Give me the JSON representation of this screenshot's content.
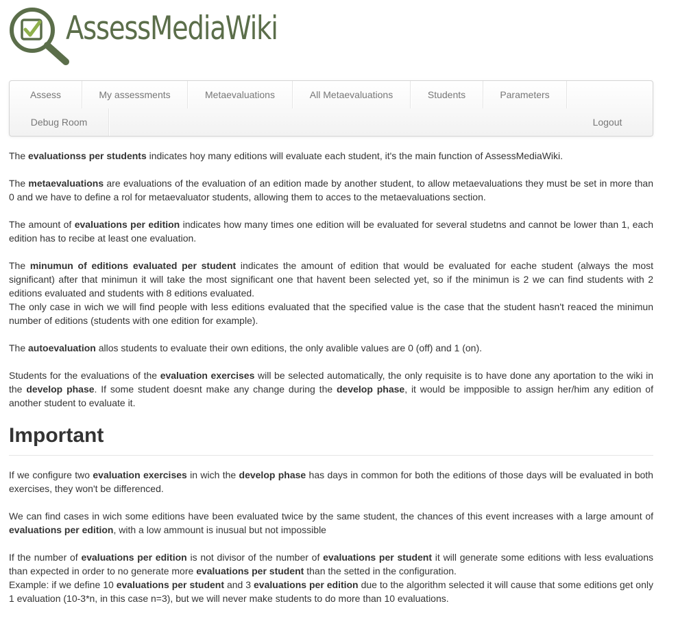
{
  "logo": {
    "text": "AssessMediaWiki",
    "icon": "magnifier-checkbox-icon",
    "color": "#5b6e4a"
  },
  "nav": {
    "row1": [
      "Assess",
      "My assessments",
      "Metaevaluations",
      "All Metaevaluations",
      "Students",
      "Parameters"
    ],
    "row2": [
      "Debug Room"
    ],
    "logout": "Logout"
  },
  "paragraphs": [
    [
      {
        "t": "The "
      },
      {
        "b": "evaluationss per students"
      },
      {
        "t": " indicates hoy many editions will evaluate each student, it's the main function of AssessMediaWiki."
      }
    ],
    [
      {
        "t": "The "
      },
      {
        "b": "metaevaluations"
      },
      {
        "t": " are evaluations of the evaluation of an edition made by another student, to allow metaevaluations they must be set in more than 0 and we have to define a rol for metaevaluator students, allowing them to acces to the metaevaluations section."
      }
    ],
    [
      {
        "t": "The amount of "
      },
      {
        "b": "evaluations per edition"
      },
      {
        "t": " indicates how many times one edition will be evaluated for several studetns and cannot be lower than 1, each edition has to recibe at least one evaluation."
      }
    ],
    [
      {
        "t": "The "
      },
      {
        "b": "minumun of editions evaluated per student"
      },
      {
        "t": " indicates the amount of edition that would be evaluated for eache student (always the most significant) after that minimun it will take the most significant one that havent been selected yet, so if the minimun is 2 we can find students with 2 editions evaluated and students with 8 editions evaluated."
      },
      {
        "br": true
      },
      {
        "t": "The only case in wich we will find people with less editions evaluated that the specified value is the case that the student hasn't reaced the minimun number of editions (students with one edition for example)."
      }
    ],
    [
      {
        "t": "The "
      },
      {
        "b": "autoevaluation"
      },
      {
        "t": " allos students to evaluate their own editions, the only avalible values are 0 (off) and 1 (on)."
      }
    ],
    [
      {
        "t": "Students for the evaluations of the "
      },
      {
        "b": "evaluation exercises"
      },
      {
        "t": " will be selected automatically, the only requisite is to have done any aportation to the wiki in the "
      },
      {
        "b": "develop phase"
      },
      {
        "t": ". If some student doesnt make any change during the "
      },
      {
        "b": "develop phase"
      },
      {
        "t": ", it would be impposible to assign her/him any edition of another student to evaluate it."
      }
    ]
  ],
  "important_heading": "Important",
  "important_paragraphs": [
    [
      {
        "t": "If we configure two "
      },
      {
        "b": "evaluation exercises"
      },
      {
        "t": " in wich the "
      },
      {
        "b": "develop phase"
      },
      {
        "t": " has days in common for both the editions of those days will be evaluated in both exercises, they won't be differenced."
      }
    ],
    [
      {
        "t": "We can find cases in wich some editions have been evaluated twice by the same student, the chances of this event increases with a large amount of "
      },
      {
        "b": "evaluations per edition"
      },
      {
        "t": ", with a low ammount is inusual but not impossible"
      }
    ],
    [
      {
        "t": "If the number of "
      },
      {
        "b": "evaluations per edition"
      },
      {
        "t": " is not divisor of the number of "
      },
      {
        "b": "evaluations per student"
      },
      {
        "t": " it will generate some editions with less evaluations than expected in order to no generate more "
      },
      {
        "b": "evaluations per student"
      },
      {
        "t": " than the setted in the configuration."
      },
      {
        "br": true
      },
      {
        "t": "Example: if we define 10 "
      },
      {
        "b": "evaluations per student"
      },
      {
        "t": " and 3 "
      },
      {
        "b": "evaluations per edition"
      },
      {
        "t": " due to the algorithm selected it will cause that some editions get only 1 evaluation (10-3*n, in this case n=3), but we will never make students to do more than 10 evaluations."
      }
    ]
  ]
}
